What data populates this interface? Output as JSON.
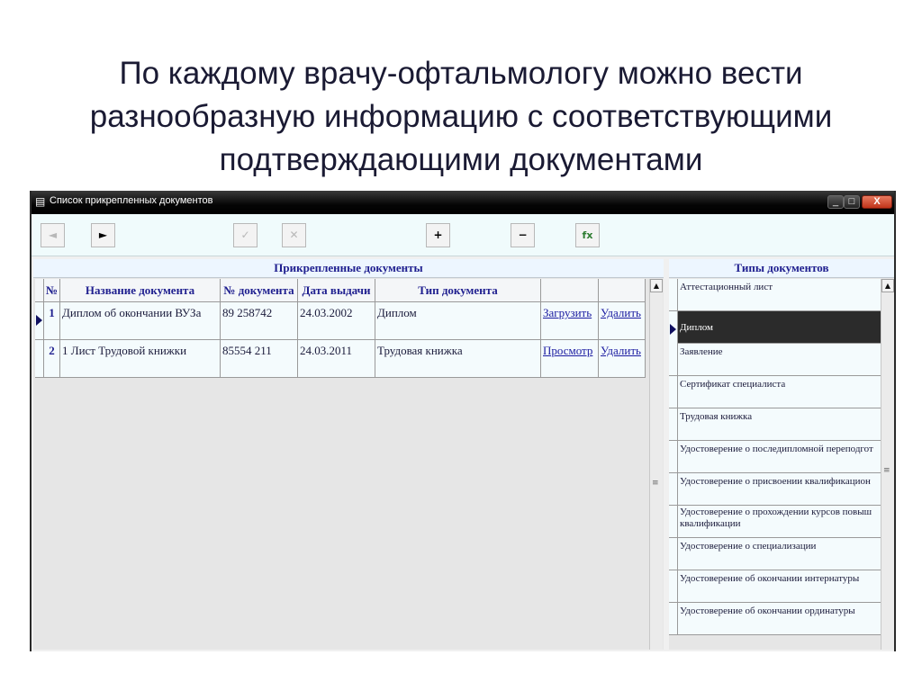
{
  "slide": {
    "title_lines": [
      "По каждому врачу-офтальмологу можно вести",
      "разнообразную информацию с соответствующими",
      "подтверждающими документами"
    ]
  },
  "window": {
    "title": "Список прикрепленных документов",
    "controls": {
      "minimize": "_",
      "maximize": "□",
      "close": "X"
    }
  },
  "toolbar": {
    "buttons": [
      {
        "name": "prev-record",
        "icon": "◄",
        "enabled": false
      },
      {
        "name": "next-record",
        "icon": "►",
        "enabled": true
      },
      {
        "name": "confirm",
        "icon": "✓",
        "enabled": false
      },
      {
        "name": "cancel",
        "icon": "✕",
        "enabled": false
      },
      {
        "name": "add",
        "icon": "+",
        "enabled": true
      },
      {
        "name": "remove",
        "icon": "−",
        "enabled": true
      },
      {
        "name": "excel-export",
        "icon": "fx",
        "enabled": true
      }
    ]
  },
  "documents": {
    "caption": "Прикрепленные документы",
    "columns": [
      "№",
      "Название документа",
      "№ документа",
      "Дата выдачи",
      "Тип документа",
      "",
      ""
    ],
    "rows": [
      {
        "num": "1",
        "name": "Диплом об окончании ВУЗа",
        "doc_no": "89 258742",
        "date": "24.03.2002",
        "type": "Диплом",
        "action1": "Загрузить",
        "action2": "Удалить",
        "current": true
      },
      {
        "num": "2",
        "name": "1 Лист Трудовой книжки",
        "doc_no": "85554 211",
        "date": "24.03.2011",
        "type": "Трудовая книжка",
        "action1": "Просмотр",
        "action2": "Удалить",
        "current": false
      }
    ]
  },
  "doc_types": {
    "caption": "Типы документов",
    "items": [
      "Аттестационный лист",
      "Диплом",
      "Заявление",
      "Сертификат специалиста",
      "Трудовая книжка",
      "Удостоверение о последипломной переподгот",
      "Удостоверение о присвоении квалификацион",
      "Удостоверение о прохождении курсов повыш квалификации",
      "Удостоверение о специализации",
      "Удостоверение об окончании интернатуры",
      "Удостоверение об окончании ординатуры"
    ],
    "selected_index": 1
  },
  "colors": {
    "titlebar": "#000000",
    "header_text": "#1f1f8f",
    "link": "#1a1aa0",
    "selected_row": "#2b2b2b",
    "cell_bg": "#f4fbfd"
  }
}
